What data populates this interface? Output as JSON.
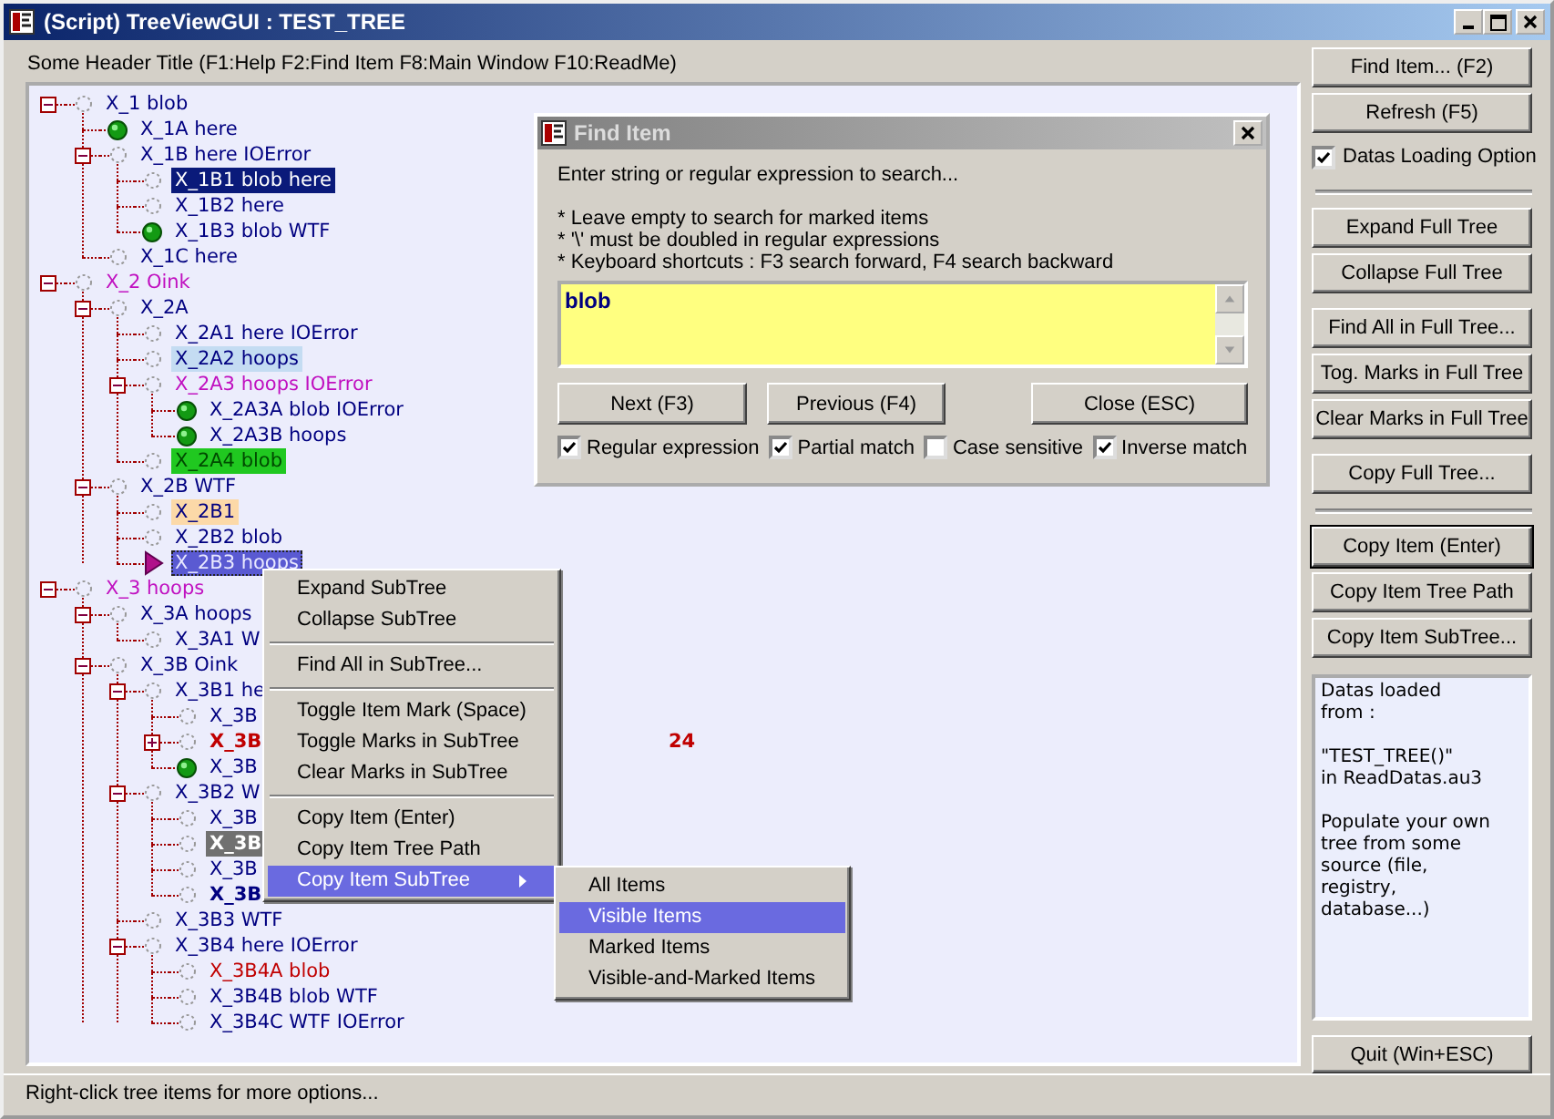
{
  "window": {
    "title": "(Script) TreeViewGUI : TEST_TREE"
  },
  "header": "Some Header Title (F1:Help F2:Find Item F8:Main Window F10:ReadMe)",
  "tree": [
    {
      "text": "X_1 blob",
      "color": "#000080",
      "marked": false,
      "expanded": true,
      "children": [
        {
          "text": "X_1A here",
          "color": "#000080",
          "marked": true
        },
        {
          "text": "X_1B here IOError",
          "color": "#000080",
          "marked": false,
          "expanded": true,
          "children": [
            {
              "text": "X_1B1 blob here",
              "kind": "selected",
              "marked": false
            },
            {
              "text": "X_1B2 here",
              "color": "#000080",
              "marked": false
            },
            {
              "text": "X_1B3 blob WTF",
              "color": "#000080",
              "marked": true
            }
          ]
        },
        {
          "text": "X_1C here",
          "color": "#000080",
          "marked": false
        }
      ]
    },
    {
      "text": "X_2 Oink",
      "color": "#c010c0",
      "marked": false,
      "expanded": true,
      "children": [
        {
          "text": "X_2A",
          "color": "#000080",
          "marked": false,
          "expanded": true,
          "children": [
            {
              "text": "X_2A1 here IOError",
              "color": "#000080",
              "marked": false
            },
            {
              "text": "X_2A2 hoops",
              "kind": "hovered",
              "marked": false
            },
            {
              "text": "X_2A3 hoops IOError",
              "color": "#c010c0",
              "marked": false,
              "expanded": true,
              "children": [
                {
                  "text": "X_2A3A blob IOError",
                  "color": "#000080",
                  "marked": true
                },
                {
                  "text": "X_2A3B hoops",
                  "color": "#000080",
                  "marked": true
                }
              ]
            },
            {
              "text": "X_2A4 blob",
              "kind": "found",
              "marked": false
            }
          ]
        },
        {
          "text": "X_2B WTF",
          "color": "#000080",
          "marked": false,
          "expanded": true,
          "children": [
            {
              "text": "X_2B1",
              "kind": "tagged",
              "marked": false
            },
            {
              "text": "X_2B2 blob",
              "color": "#000080",
              "marked": false
            },
            {
              "text": "X_2B3 hoops",
              "kind": "current",
              "focused": true
            }
          ]
        }
      ]
    },
    {
      "text": "X_3 hoops",
      "color": "#c010c0",
      "marked": false,
      "expanded": true,
      "children": [
        {
          "text": "X_3A hoops",
          "color": "#000080",
          "marked": false,
          "expanded": true,
          "children": [
            {
              "text": "X_3A1 W",
              "color": "#000080",
              "marked": false
            }
          ]
        },
        {
          "text": "X_3B Oink",
          "color": "#000080",
          "marked": false,
          "expanded": true,
          "children": [
            {
              "text": "X_3B1 he",
              "color": "#000080",
              "marked": false,
              "expanded": true,
              "children": [
                {
                  "text": "X_3B",
                  "color": "#000080",
                  "marked": false
                },
                {
                  "text": "X_3B",
                  "color": "#c00000",
                  "bold": true,
                  "marked": false,
                  "expanded": false,
                  "tail": "24"
                },
                {
                  "text": "X_3B",
                  "color": "#000080",
                  "marked": true
                }
              ]
            },
            {
              "text": "X_3B2 W",
              "color": "#000080",
              "marked": false,
              "expanded": true,
              "children": [
                {
                  "text": "X_3B",
                  "color": "#000080",
                  "marked": false
                },
                {
                  "text": "X_3B",
                  "kind": "dimmed",
                  "bold": true,
                  "marked": false
                },
                {
                  "text": "X_3B",
                  "color": "#000080",
                  "marked": false
                },
                {
                  "text": "X_3B",
                  "color": "#000080",
                  "bold": true,
                  "marked": false
                }
              ]
            },
            {
              "text": "X_3B3 WTF",
              "color": "#000080",
              "marked": false
            },
            {
              "text": "X_3B4 here IOError",
              "color": "#000080",
              "marked": false,
              "expanded": true,
              "children": [
                {
                  "text": "X_3B4A blob",
                  "color": "#c00000",
                  "marked": false
                },
                {
                  "text": "X_3B4B blob WTF",
                  "color": "#000080",
                  "marked": false
                },
                {
                  "text": "X_3B4C WTF IOError",
                  "color": "#000080",
                  "marked": false
                }
              ]
            }
          ]
        }
      ]
    }
  ],
  "find_dialog": {
    "title": "Find Item",
    "intro": "Enter string or regular expression to search...",
    "notes": [
      "* Leave empty to search for marked items",
      "* '\\' must be doubled in regular expressions",
      "* Keyboard shortcuts : F3 search forward, F4 search backward"
    ],
    "query": "blob",
    "buttons": [
      "Next (F3)",
      "Previous (F4)",
      "Close (ESC)"
    ],
    "options": [
      {
        "label": "Regular expression",
        "checked": true
      },
      {
        "label": "Partial match",
        "checked": true
      },
      {
        "label": "Case sensitive",
        "checked": false
      },
      {
        "label": "Inverse match",
        "checked": true
      }
    ]
  },
  "context_menu": [
    [
      {
        "label": "Expand SubTree",
        "selected": false
      },
      {
        "label": "Collapse SubTree",
        "selected": false
      }
    ],
    [
      {
        "label": "Find All in SubTree...",
        "selected": false
      }
    ],
    [
      {
        "label": "Toggle Item Mark (Space)",
        "selected": false
      },
      {
        "label": "Toggle Marks in SubTree",
        "selected": false
      },
      {
        "label": "Clear Marks in SubTree",
        "selected": false
      }
    ],
    [
      {
        "label": "Copy Item (Enter)",
        "selected": false
      },
      {
        "label": "Copy Item Tree Path",
        "selected": false
      },
      {
        "label": "Copy Item SubTree",
        "selected": true,
        "submenu": true
      }
    ]
  ],
  "submenu": [
    {
      "label": "All Items",
      "selected": false
    },
    {
      "label": "Visible Items",
      "selected": true
    },
    {
      "label": "Marked Items",
      "selected": false
    },
    {
      "label": "Visible-and-Marked Items",
      "selected": false
    }
  ],
  "side_panel": [
    [
      {
        "kind": "button",
        "label": "Find Item... (F2)",
        "default": false
      },
      {
        "kind": "button",
        "label": "Refresh (F5)",
        "default": false
      },
      {
        "kind": "checkbox",
        "label": "Datas Loading Option",
        "checked": true
      }
    ],
    [
      {
        "kind": "button",
        "label": "Expand Full Tree",
        "default": false
      },
      {
        "kind": "button",
        "label": "Collapse Full Tree",
        "default": false
      }
    ],
    [
      {
        "kind": "button",
        "label": "Find All in Full Tree...",
        "default": false
      },
      {
        "kind": "button",
        "label": "Tog. Marks in Full Tree",
        "default": false
      },
      {
        "kind": "button",
        "label": "Clear Marks in Full Tree",
        "default": false
      }
    ],
    [
      {
        "kind": "button",
        "label": "Copy Full Tree...",
        "default": false
      }
    ],
    [
      {
        "kind": "button",
        "label": "Copy Item (Enter)",
        "default": true
      },
      {
        "kind": "button",
        "label": "Copy Item Tree Path",
        "default": false
      },
      {
        "kind": "button",
        "label": "Copy Item SubTree...",
        "default": false
      }
    ]
  ],
  "info": [
    "Datas loaded\nfrom :",
    "\"TEST_TREE()\"\nin ReadDatas.au3",
    "Populate your own\ntree from some\nsource (file,\nregistry,\ndatabase...)"
  ],
  "quit_button": "Quit (Win+ESC)",
  "status_bar": "Right-click tree items for more options..."
}
